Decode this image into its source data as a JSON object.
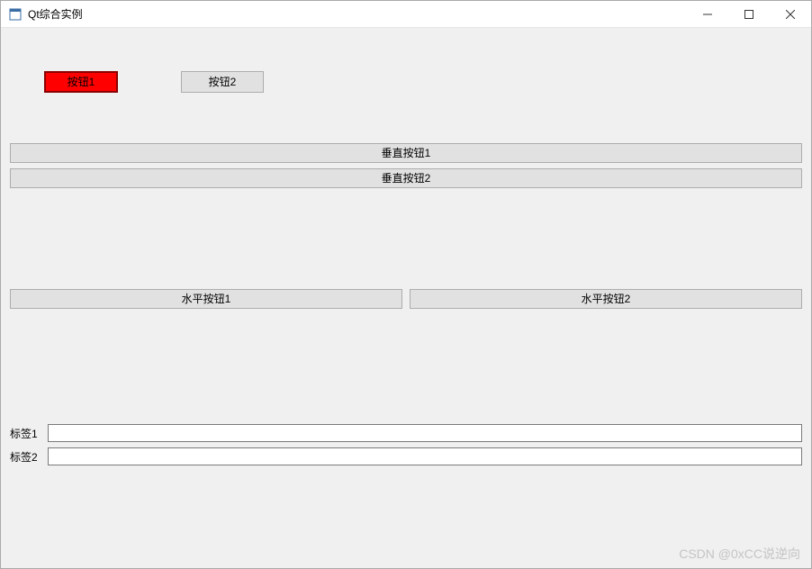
{
  "window": {
    "title": "Qt综合实例"
  },
  "topButtons": {
    "btn1": "按钮1",
    "btn2": "按钮2"
  },
  "verticalButtons": {
    "btn1": "垂直按钮1",
    "btn2": "垂直按钮2"
  },
  "horizontalButtons": {
    "btn1": "水平按钮1",
    "btn2": "水平按钮2"
  },
  "form": {
    "label1": "标签1",
    "value1": "",
    "label2": "标签2",
    "value2": ""
  },
  "watermark": "CSDN @0xCC说逆向"
}
